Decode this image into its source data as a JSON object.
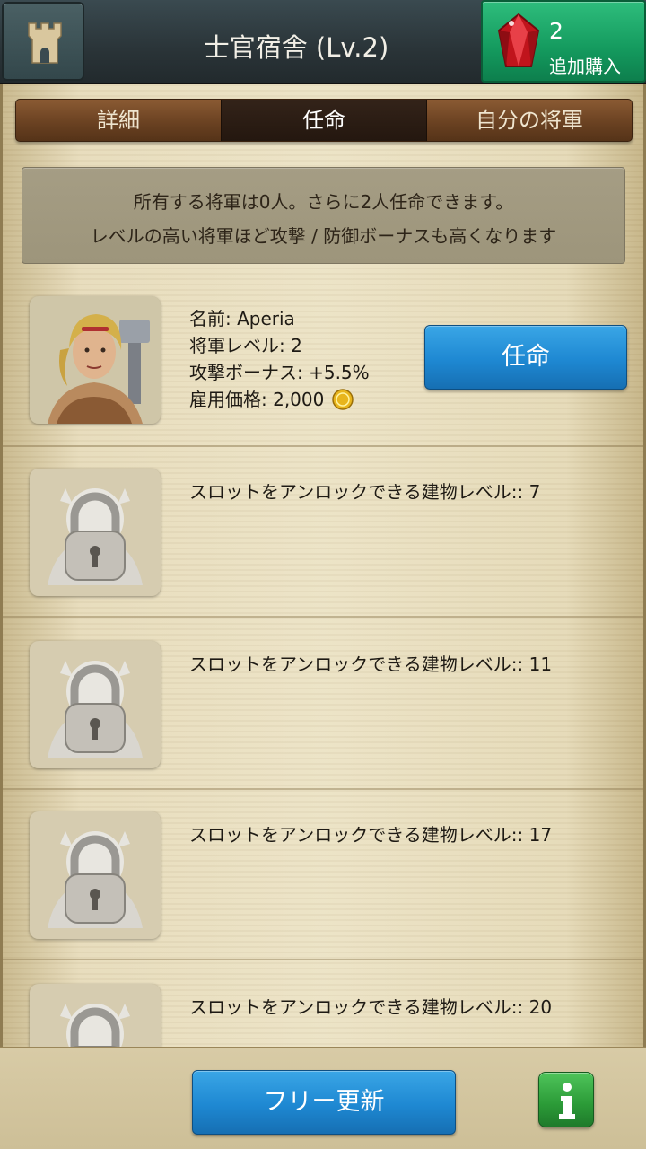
{
  "header": {
    "title": "士官宿舎 (Lv.2)",
    "home_icon": "castle-tower-icon",
    "gem_count": "2",
    "buy_label": "追加購入",
    "gem_icon": "red-gem-icon"
  },
  "tabs": [
    {
      "label": "詳細",
      "active": false
    },
    {
      "label": "任命",
      "active": true
    },
    {
      "label": "自分の将軍",
      "active": false
    }
  ],
  "info": {
    "line1": "所有する将軍は0人。さらに2人任命できます。",
    "line2": "レベルの高い将軍ほど攻撃 / 防御ボーナスも高くなります"
  },
  "hero": {
    "name": "名前: Aperia",
    "level": "将軍レベル: 2",
    "bonus": "攻撃ボーナス: +5.5%",
    "price": "雇用価格: 2,000",
    "appoint_label": "任命",
    "coin_icon": "gold-coin-icon"
  },
  "locked_slots": [
    {
      "text": "スロットをアンロックできる建物レベル:: 7"
    },
    {
      "text": "スロットをアンロックできる建物レベル:: 11"
    },
    {
      "text": "スロットをアンロックできる建物レベル:: 17"
    },
    {
      "text": "スロットをアンロックできる建物レベル:: 20"
    }
  ],
  "footer": {
    "free_refresh_label": "フリー更新",
    "info_icon": "info-icon"
  },
  "colors": {
    "accent_blue": "#1e88d2",
    "buy_green": "#149a5e",
    "tab_brown": "#6b4222"
  }
}
